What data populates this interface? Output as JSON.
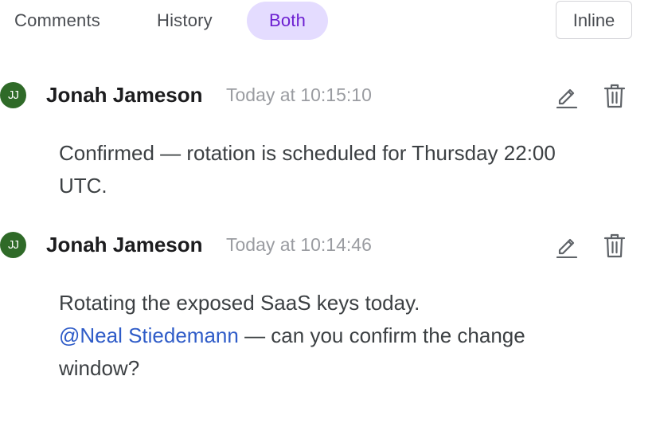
{
  "tabs": {
    "comments": "Comments",
    "history": "History",
    "both": "Both",
    "inline": "Inline"
  },
  "comments": [
    {
      "avatar_initials": "JJ",
      "avatar_color": "#2f6a28",
      "author": "Jonah Jameson",
      "timestamp": "Today at 10:15:10",
      "body_line1": "Confirmed — rotation is scheduled for Thursday 22:00 UTC.",
      "edit_icon": "pencil-icon",
      "delete_icon": "trash-icon"
    },
    {
      "avatar_initials": "JJ",
      "avatar_color": "#2f6a28",
      "author": "Jonah Jameson",
      "timestamp": "Today at 10:14:46",
      "body_line1": "Rotating the exposed SaaS keys today.",
      "mention": "@Neal Stiedemann",
      "body_after_mention": " — can you confirm the change window?",
      "edit_icon": "pencil-icon",
      "delete_icon": "trash-icon"
    }
  ],
  "colors": {
    "active_tab_bg": "#e4dcff",
    "active_tab_text": "#6c1fd1",
    "mention": "#2f5cc8"
  }
}
